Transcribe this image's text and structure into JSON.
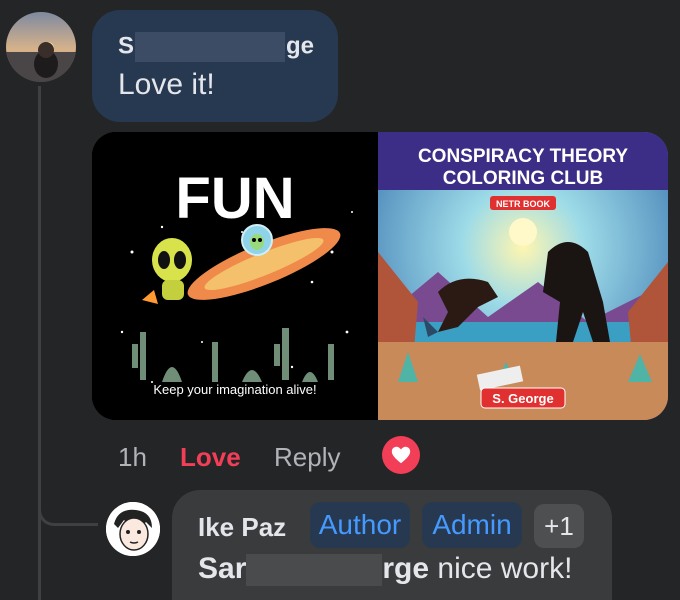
{
  "comment": {
    "author_name_start": "S",
    "author_name_end": "ge",
    "text": "Love it!",
    "images": [
      {
        "title": "FUN",
        "caption": "Keep your imagination alive!"
      },
      {
        "title_line1": "CONSPIRACY THEORY",
        "title_line2": "COLORING CLUB",
        "badge": "NETR BOOK",
        "author": "S. George"
      }
    ]
  },
  "actions": {
    "time": "1h",
    "love": "Love",
    "reply": "Reply",
    "reaction_icon": "heart-icon"
  },
  "reply": {
    "author": "Ike Paz",
    "badges": [
      "Author",
      "Admin",
      "+1"
    ],
    "mention_start": "Sar",
    "mention_end": "rge",
    "text": " nice work!"
  },
  "colors": {
    "background": "#242526",
    "bubble_own": "#263951",
    "bubble_reply": "#3a3b3c",
    "love": "#f33e58",
    "badge_text": "#4599ff"
  }
}
